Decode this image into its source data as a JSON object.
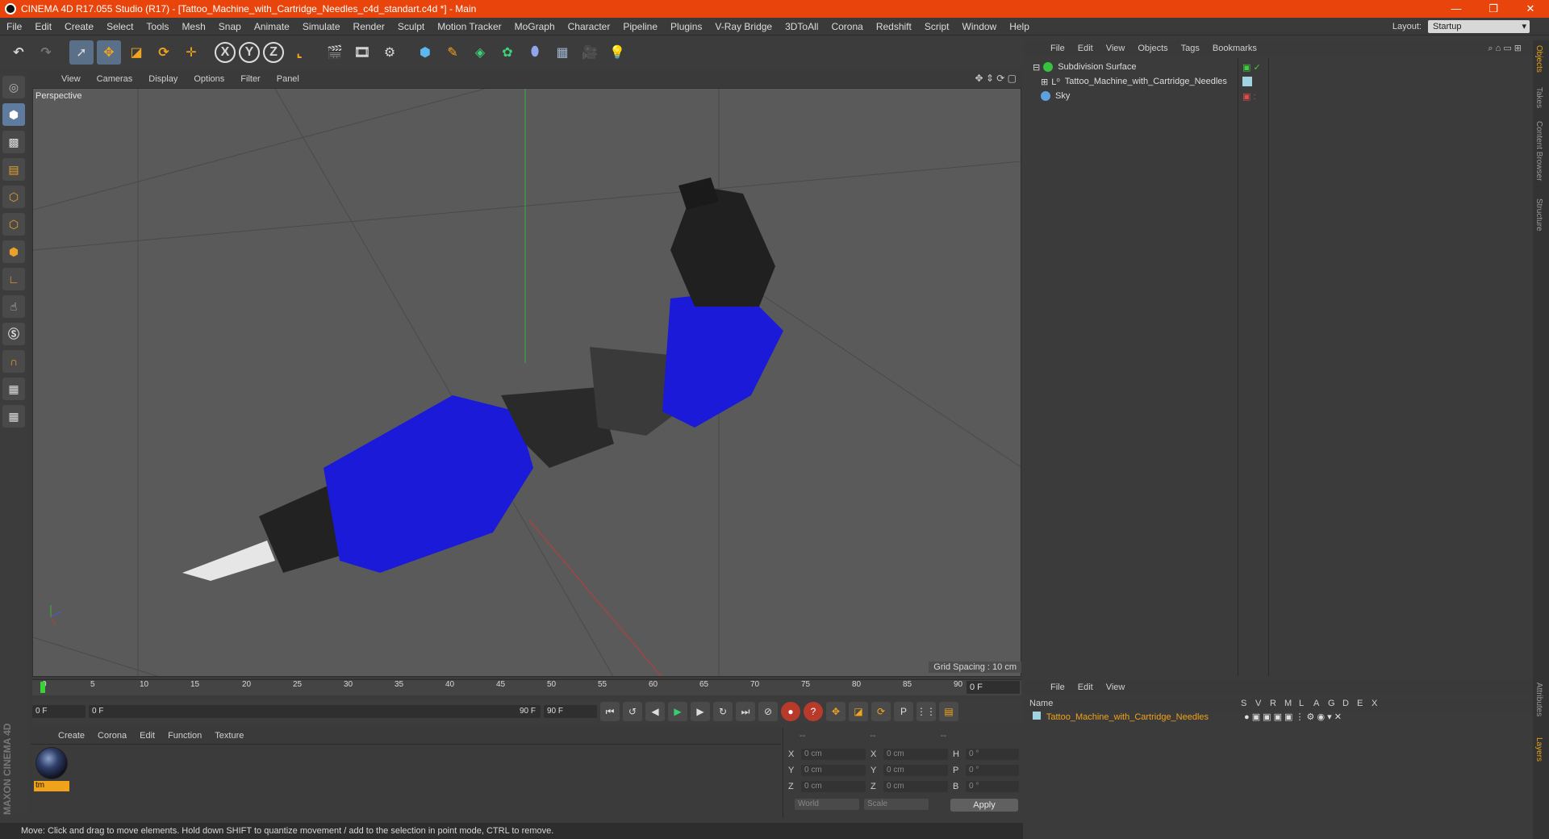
{
  "window": {
    "title": "CINEMA 4D R17.055 Studio (R17) - [Tattoo_Machine_with_Cartridge_Needles_c4d_standart.c4d *] - Main",
    "controls": [
      "—",
      "❐",
      "✕"
    ]
  },
  "menubar": {
    "items": [
      "File",
      "Edit",
      "Create",
      "Select",
      "Tools",
      "Mesh",
      "Snap",
      "Animate",
      "Simulate",
      "Render",
      "Sculpt",
      "Motion Tracker",
      "MoGraph",
      "Character",
      "Pipeline",
      "Plugins",
      "V-Ray Bridge",
      "3DToAll",
      "Corona",
      "Redshift",
      "Script",
      "Window",
      "Help"
    ],
    "layout_label": "Layout:",
    "layout_value": "Startup"
  },
  "toolbar": {
    "axis_x": "X",
    "axis_y": "Y",
    "axis_z": "Z"
  },
  "viewport": {
    "menu": [
      "View",
      "Cameras",
      "Display",
      "Options",
      "Filter",
      "Panel"
    ],
    "label": "Perspective",
    "grid_spacing": "Grid Spacing : 10 cm"
  },
  "timeline": {
    "ticks": [
      "0",
      "5",
      "10",
      "15",
      "20",
      "25",
      "30",
      "35",
      "40",
      "45",
      "50",
      "55",
      "60",
      "65",
      "70",
      "75",
      "80",
      "85",
      "90"
    ],
    "current_frame_right": "0 F",
    "start_field": "0 F",
    "range_start": "0 F",
    "range_end": "90 F",
    "end_field": "90 F"
  },
  "material_manager": {
    "menu": [
      "Create",
      "Corona",
      "Edit",
      "Function",
      "Texture"
    ],
    "material_name": "tm"
  },
  "coordinates": {
    "header": [
      "--",
      "--",
      "--"
    ],
    "rows": [
      {
        "l1": "X",
        "v1": "0 cm",
        "l2": "X",
        "v2": "0 cm",
        "l3": "H",
        "v3": "0 °"
      },
      {
        "l1": "Y",
        "v1": "0 cm",
        "l2": "Y",
        "v2": "0 cm",
        "l3": "P",
        "v3": "0 °"
      },
      {
        "l1": "Z",
        "v1": "0 cm",
        "l2": "Z",
        "v2": "0 cm",
        "l3": "B",
        "v3": "0 °"
      }
    ],
    "mode_world": "World",
    "mode_scale": "Scale",
    "apply": "Apply"
  },
  "statusbar": {
    "text": "Move: Click and drag to move elements. Hold down SHIFT to quantize movement / add to the selection in point mode, CTRL to remove."
  },
  "object_manager": {
    "menu": [
      "File",
      "Edit",
      "View",
      "Objects",
      "Tags",
      "Bookmarks"
    ],
    "objects": [
      {
        "name": "Subdivision Surface",
        "color": "#35c23f"
      },
      {
        "name": "Tattoo_Machine_with_Cartridge_Needles",
        "color": "#9fd4e0"
      },
      {
        "name": "Sky",
        "color": "#5fa0e0"
      }
    ]
  },
  "layer_manager": {
    "menu": [
      "File",
      "Edit",
      "View"
    ],
    "columns": [
      "Name",
      "S",
      "V",
      "R",
      "M",
      "L",
      "A",
      "G",
      "D",
      "E",
      "X"
    ],
    "layer_name": "Tattoo_Machine_with_Cartridge_Needles"
  },
  "side_tabs": [
    "Objects",
    "Takes",
    "Content Browser",
    "Structure",
    "Attributes",
    "Layers"
  ],
  "brand": "MAXON CINEMA 4D"
}
